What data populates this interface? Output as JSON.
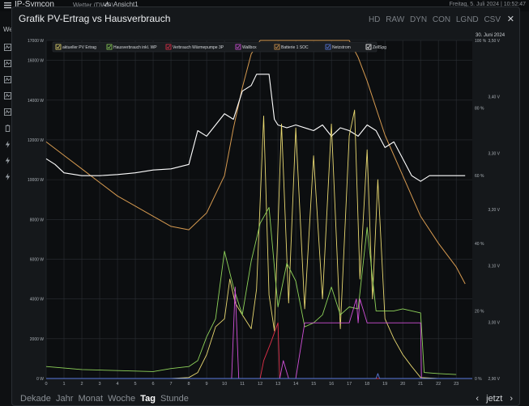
{
  "app": {
    "brand": "IP-Symcon",
    "weather": "Wetter (DWD)",
    "view": "Ansicht1",
    "datetime": "Freitag, 5. Juli 2024 | 10:52:47"
  },
  "sidebar": {
    "label": "Web"
  },
  "panel": {
    "title": "Grafik PV-Ertrag vs Hausverbrauch",
    "toolbar": [
      "HD",
      "RAW",
      "DYN",
      "CON",
      "LGND",
      "CSV"
    ],
    "toolbar_active": [
      "HD",
      "LGND"
    ],
    "periods": [
      "Dekade",
      "Jahr",
      "Monat",
      "Woche",
      "Tag",
      "Stunde"
    ],
    "period_active": "Tag",
    "nav_prev": "‹",
    "nav_now": "jetzt",
    "nav_next": "›"
  },
  "chart_data": {
    "type": "line",
    "date_label": "30. Juni 2024",
    "x_ticks": [
      "0",
      "1",
      "2",
      "3",
      "4",
      "5",
      "6",
      "7",
      "8",
      "9",
      "10",
      "11",
      "12",
      "13",
      "14",
      "15",
      "16",
      "17",
      "18",
      "19",
      "20",
      "21",
      "22",
      "23"
    ],
    "y_left_ticks": [
      "0 W",
      "2000 W",
      "4000 W",
      "6000 W",
      "8000 W",
      "10000 W",
      "12000 W",
      "14000 W",
      "16000 W",
      "17000 W"
    ],
    "y_pct_ticks": [
      "0 %",
      "20 %",
      "40 %",
      "60 %",
      "80 %",
      "100 %"
    ],
    "y_volt_ticks": [
      "2,90 V",
      "3,00 V",
      "3,10 V",
      "3,20 V",
      "3,30 V",
      "3,40 V",
      "3,50 V"
    ],
    "legend": [
      {
        "label": "aktueller PV Ertrag",
        "color": "#e8d870"
      },
      {
        "label": "Hausverbrauch inkl. WP",
        "color": "#8fd45a"
      },
      {
        "label": "Verbrauch Wärmepumpe 3P",
        "color": "#e0304a"
      },
      {
        "label": "Wallbox",
        "color": "#d050d8"
      },
      {
        "label": "Batterie 1 SOC",
        "color": "#d69a50"
      },
      {
        "label": "Netzstrom",
        "color": "#5a7adf"
      },
      {
        "label": "ZellSpg",
        "color": "#ffffff"
      }
    ],
    "series": [
      {
        "name": "Batterie 1 SOC",
        "axis": "pct",
        "x": [
          0,
          1,
          2,
          3,
          4,
          5,
          6,
          7,
          8,
          9,
          10,
          10.5,
          11,
          11.5,
          12,
          12.5,
          14,
          15,
          16,
          17,
          17.5,
          18,
          18.5,
          19,
          20,
          21,
          22,
          23,
          23.5
        ],
        "y": [
          70,
          66,
          62,
          58,
          54,
          51,
          48,
          45,
          44,
          49,
          60,
          74,
          86,
          96,
          100,
          100,
          100,
          100,
          100,
          100,
          95,
          88,
          80,
          72,
          60,
          48,
          40,
          33,
          28
        ]
      },
      {
        "name": "ZellSpg",
        "axis": "volt",
        "x": [
          0,
          0.5,
          1,
          2,
          3,
          4,
          5,
          6,
          7,
          8,
          8.5,
          9,
          9.5,
          10,
          10.5,
          11,
          11.5,
          11.8,
          12.5,
          12.8,
          13,
          13.5,
          14,
          15,
          15.5,
          16,
          16.5,
          17,
          17.5,
          18,
          18.5,
          19,
          19.5,
          20,
          20.5,
          21,
          21.5,
          22,
          23,
          23.5
        ],
        "y": [
          3.29,
          3.28,
          3.265,
          3.26,
          3.26,
          3.262,
          3.265,
          3.27,
          3.272,
          3.28,
          3.34,
          3.33,
          3.35,
          3.37,
          3.36,
          3.41,
          3.42,
          3.44,
          3.44,
          3.36,
          3.35,
          3.345,
          3.35,
          3.34,
          3.35,
          3.33,
          3.345,
          3.34,
          3.33,
          3.35,
          3.34,
          3.31,
          3.32,
          3.29,
          3.26,
          3.25,
          3.26,
          3.26,
          3.26,
          3.26
        ]
      },
      {
        "name": "aktueller PV Ertrag",
        "axis": "left",
        "x": [
          0,
          5,
          6,
          7,
          8,
          8.5,
          9,
          9.5,
          10,
          10.3,
          10.6,
          11,
          11.5,
          11.8,
          12.2,
          12.5,
          12.8,
          13.2,
          13.6,
          14,
          14.5,
          15,
          15.5,
          16,
          16.5,
          17,
          17.3,
          17.6,
          18,
          18.3,
          18.6,
          19,
          19.5,
          20,
          20.5,
          21,
          22,
          23
        ],
        "y": [
          0,
          0,
          0,
          0,
          50,
          300,
          1200,
          2600,
          3000,
          5000,
          3800,
          3200,
          2500,
          4500,
          13200,
          4200,
          2400,
          12800,
          3800,
          12600,
          3500,
          11200,
          4000,
          12800,
          2500,
          12200,
          13500,
          5000,
          11500,
          4000,
          10000,
          3000,
          2000,
          1200,
          600,
          50,
          0,
          0
        ]
      },
      {
        "name": "Hausverbrauch inkl. WP",
        "axis": "left",
        "x": [
          0,
          2,
          4,
          6,
          7,
          8,
          8.5,
          9,
          9.5,
          10,
          10.5,
          11,
          11.5,
          12,
          12.5,
          13,
          13.5,
          14,
          14.5,
          15,
          15.5,
          16,
          16.5,
          17,
          17.5,
          18,
          18.5,
          19,
          19.5,
          20,
          20.5,
          21,
          21.2,
          22,
          23
        ],
        "y": [
          600,
          450,
          400,
          350,
          500,
          600,
          900,
          2100,
          3000,
          6400,
          4600,
          3200,
          5900,
          7800,
          8600,
          3600,
          5800,
          4900,
          2600,
          2800,
          3200,
          4600,
          3200,
          3600,
          3500,
          7600,
          3400,
          3400,
          3400,
          3500,
          3400,
          3300,
          300,
          250,
          200
        ]
      },
      {
        "name": "Verbrauch Wärmepumpe 3P",
        "axis": "left",
        "x": [
          0,
          12,
          12.2,
          12.6,
          13,
          13.1,
          16.9,
          17,
          21
        ],
        "y": [
          0,
          0,
          900,
          1800,
          2800,
          0,
          0,
          0,
          0
        ]
      },
      {
        "name": "Wallbox",
        "axis": "left",
        "x": [
          0,
          10,
          10.4,
          10.6,
          10.8,
          11,
          13,
          13.1,
          13.3,
          13.6,
          13.8,
          14,
          14.5,
          15,
          16.9,
          17,
          17.4,
          17.5,
          17.6,
          18,
          20,
          21,
          21.05,
          24
        ],
        "y": [
          0,
          0,
          0,
          4600,
          0,
          0,
          0,
          0,
          900,
          0,
          0,
          0,
          2800,
          2800,
          2800,
          2800,
          4000,
          2800,
          4000,
          2800,
          2800,
          2800,
          0,
          0
        ]
      },
      {
        "name": "Netzstrom",
        "axis": "left",
        "x": [
          0,
          18.5,
          18.6,
          18.7,
          24
        ],
        "y": [
          0,
          0,
          250,
          0,
          0
        ]
      }
    ]
  }
}
